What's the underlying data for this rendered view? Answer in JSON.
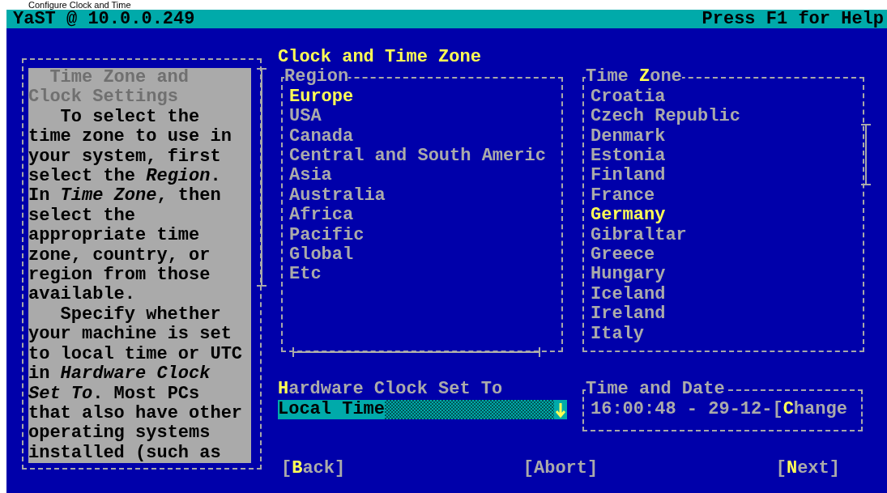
{
  "window": {
    "title": "Configure Clock and Time"
  },
  "header": {
    "host": "YaST @ 10.0.0.249",
    "help_hint": "Press F1 for Help"
  },
  "help": {
    "heading": "Time Zone and Clock Settings",
    "paragraphs": [
      "To select the time zone to use in your system, first select the *Region*. In *Time Zone*, then select the appropriate time zone, country, or region from those available.",
      "Specify whether your machine is set to local time or UTC in *Hardware Clock Set To*. Most PCs that also have other operating systems installed (such as"
    ]
  },
  "dialog_title": "Clock and Time Zone",
  "region_list": {
    "title": "Region",
    "items": [
      {
        "label": "Europe",
        "selected": true
      },
      {
        "label": "USA",
        "selected": false
      },
      {
        "label": "Canada",
        "selected": false
      },
      {
        "label": "Central and South Americ",
        "selected": false
      },
      {
        "label": "Asia",
        "selected": false
      },
      {
        "label": "Australia",
        "selected": false
      },
      {
        "label": "Africa",
        "selected": false
      },
      {
        "label": "Pacific",
        "selected": false
      },
      {
        "label": "Global",
        "selected": false
      },
      {
        "label": "Etc",
        "selected": false
      }
    ]
  },
  "timezone_list": {
    "title": "Time **Z**one",
    "items": [
      {
        "label": "Croatia",
        "selected": false
      },
      {
        "label": "Czech Republic",
        "selected": false
      },
      {
        "label": "Denmark",
        "selected": false
      },
      {
        "label": "Estonia",
        "selected": false
      },
      {
        "label": "Finland",
        "selected": false
      },
      {
        "label": "France",
        "selected": false
      },
      {
        "label": "Germany",
        "selected": true
      },
      {
        "label": "Gibraltar",
        "selected": false
      },
      {
        "label": "Greece",
        "selected": false
      },
      {
        "label": "Hungary",
        "selected": false
      },
      {
        "label": "Iceland",
        "selected": false
      },
      {
        "label": "Ireland",
        "selected": false
      },
      {
        "label": "Italy",
        "selected": false
      }
    ]
  },
  "hardware_clock": {
    "label": "**H**ardware Clock Set To",
    "value": "Local Time"
  },
  "time_and_date": {
    "title": "Time and Date",
    "value": "16:00:48 - 29-12-",
    "button": "[**C**hange"
  },
  "buttons": [
    {
      "label": "[**B**ack]"
    },
    {
      "label": "[Abort]"
    },
    {
      "label": "[**N**ext]"
    }
  ]
}
